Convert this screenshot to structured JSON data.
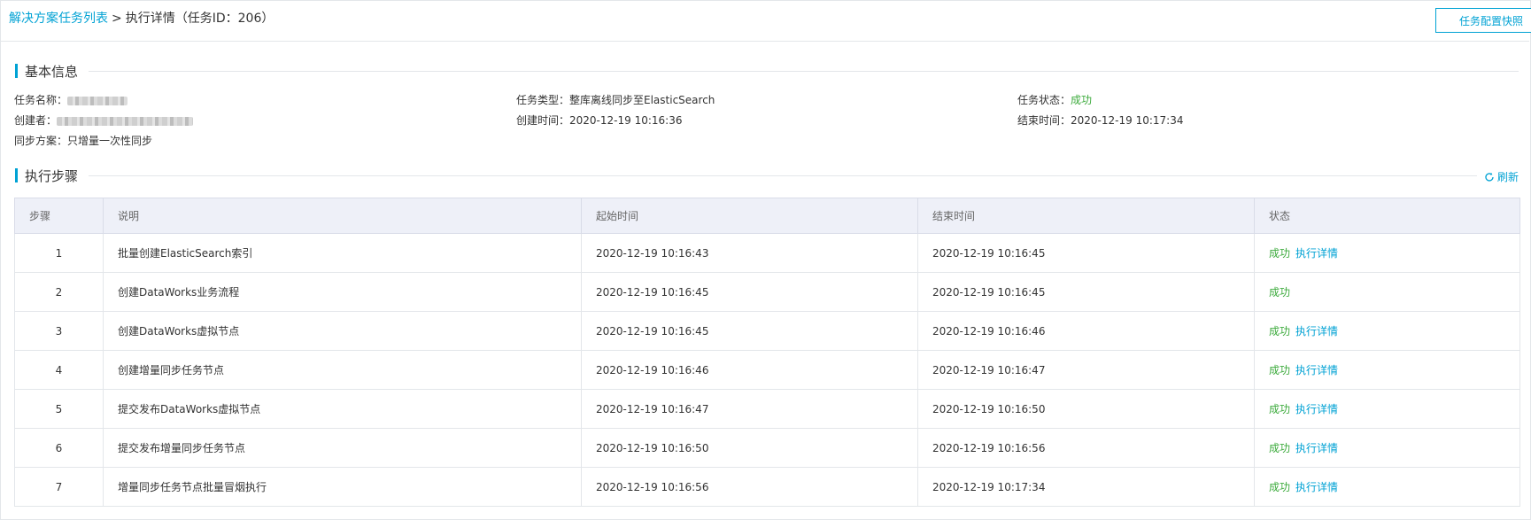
{
  "breadcrumb": {
    "parent": "解决方案任务列表",
    "separator": ">",
    "current": "执行详情（任务ID：206）"
  },
  "header": {
    "snapshot_button": "任务配置快照"
  },
  "basic_info": {
    "title": "基本信息",
    "task_name_label": "任务名称：",
    "creator_label": "创建者：",
    "sync_plan_label": "同步方案：",
    "sync_plan_value": "只增量一次性同步",
    "task_type_label": "任务类型：",
    "task_type_value": "整库离线同步至ElasticSearch",
    "create_time_label": "创建时间：",
    "create_time_value": "2020-12-19 10:16:36",
    "task_status_label": "任务状态：",
    "task_status_value": "成功",
    "end_time_label": "结束时间：",
    "end_time_value": "2020-12-19 10:17:34"
  },
  "steps_section": {
    "title": "执行步骤",
    "refresh_label": "刷新",
    "columns": [
      "步骤",
      "说明",
      "起始时间",
      "结束时间",
      "状态"
    ],
    "rows": [
      {
        "step": "1",
        "desc": "批量创建ElasticSearch索引",
        "start": "2020-12-19 10:16:43",
        "end": "2020-12-19 10:16:45",
        "status": "成功",
        "detail": "执行详情"
      },
      {
        "step": "2",
        "desc": "创建DataWorks业务流程",
        "start": "2020-12-19 10:16:45",
        "end": "2020-12-19 10:16:45",
        "status": "成功",
        "detail": ""
      },
      {
        "step": "3",
        "desc": "创建DataWorks虚拟节点",
        "start": "2020-12-19 10:16:45",
        "end": "2020-12-19 10:16:46",
        "status": "成功",
        "detail": "执行详情"
      },
      {
        "step": "4",
        "desc": "创建增量同步任务节点",
        "start": "2020-12-19 10:16:46",
        "end": "2020-12-19 10:16:47",
        "status": "成功",
        "detail": "执行详情"
      },
      {
        "step": "5",
        "desc": "提交发布DataWorks虚拟节点",
        "start": "2020-12-19 10:16:47",
        "end": "2020-12-19 10:16:50",
        "status": "成功",
        "detail": "执行详情"
      },
      {
        "step": "6",
        "desc": "提交发布增量同步任务节点",
        "start": "2020-12-19 10:16:50",
        "end": "2020-12-19 10:16:56",
        "status": "成功",
        "detail": "执行详情"
      },
      {
        "step": "7",
        "desc": "增量同步任务节点批量冒烟执行",
        "start": "2020-12-19 10:16:56",
        "end": "2020-12-19 10:17:34",
        "status": "成功",
        "detail": "执行详情"
      }
    ]
  },
  "colors": {
    "accent": "#00a2d4",
    "success": "#3dab3d",
    "header_bg": "#eef0f8"
  },
  "icons": {
    "refresh": "refresh-icon"
  }
}
